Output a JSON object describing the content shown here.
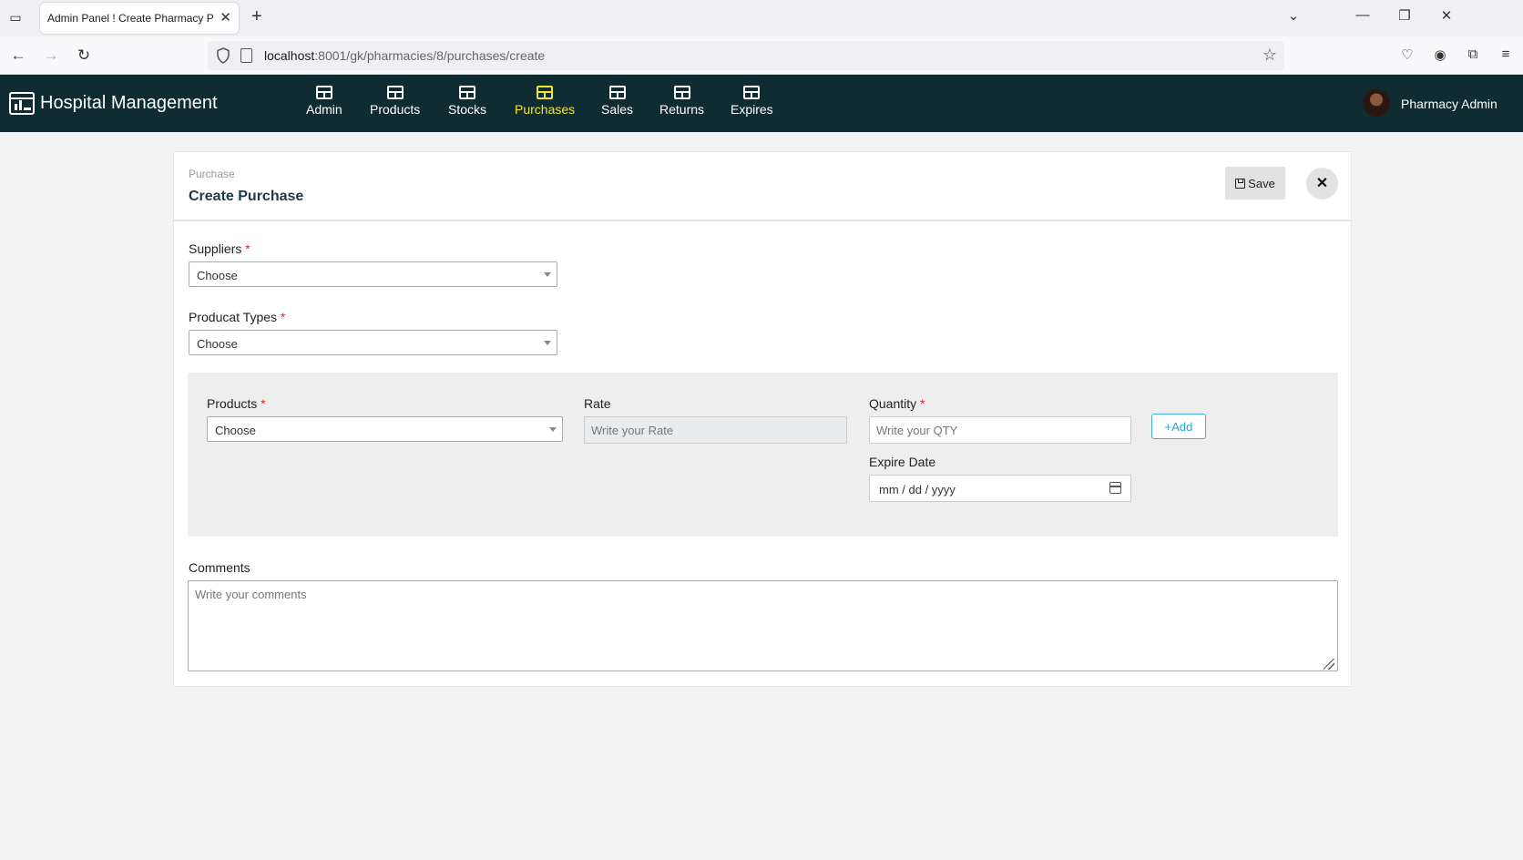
{
  "browser": {
    "tab_title": "Admin Panel ! Create Pharmacy Pur",
    "url_host": "localhost",
    "url_rest": ":8001/gk/pharmacies/8/purchases/create"
  },
  "app": {
    "brand": "Hospital Management",
    "menu": [
      {
        "label": "Admin"
      },
      {
        "label": "Products"
      },
      {
        "label": "Stocks"
      },
      {
        "label": "Purchases",
        "active": true
      },
      {
        "label": "Sales"
      },
      {
        "label": "Returns"
      },
      {
        "label": "Expires"
      }
    ],
    "user_name": "Pharmacy Admin",
    "colors": {
      "header_bg": "#0f2c33",
      "active_menu": "#f5e52a"
    }
  },
  "page": {
    "breadcrumb": "Purchase",
    "title": "Create Purchase",
    "save_label": "Save",
    "close_label": "✕"
  },
  "form": {
    "suppliers": {
      "label": "Suppliers",
      "required": "*",
      "value": "Choose"
    },
    "product_types": {
      "label": "Producat Types",
      "required": "*",
      "value": "Choose"
    },
    "products": {
      "label": "Products",
      "required": "*",
      "value": "Choose"
    },
    "rate": {
      "label": "Rate",
      "placeholder": "Write your Rate"
    },
    "quantity": {
      "label": "Quantity",
      "required": "*",
      "placeholder": "Write your QTY"
    },
    "expire_date": {
      "label": "Expire Date",
      "placeholder": "mm / dd / yyyy"
    },
    "add_label": "Add",
    "comments": {
      "label": "Comments",
      "placeholder": "Write your comments"
    }
  }
}
